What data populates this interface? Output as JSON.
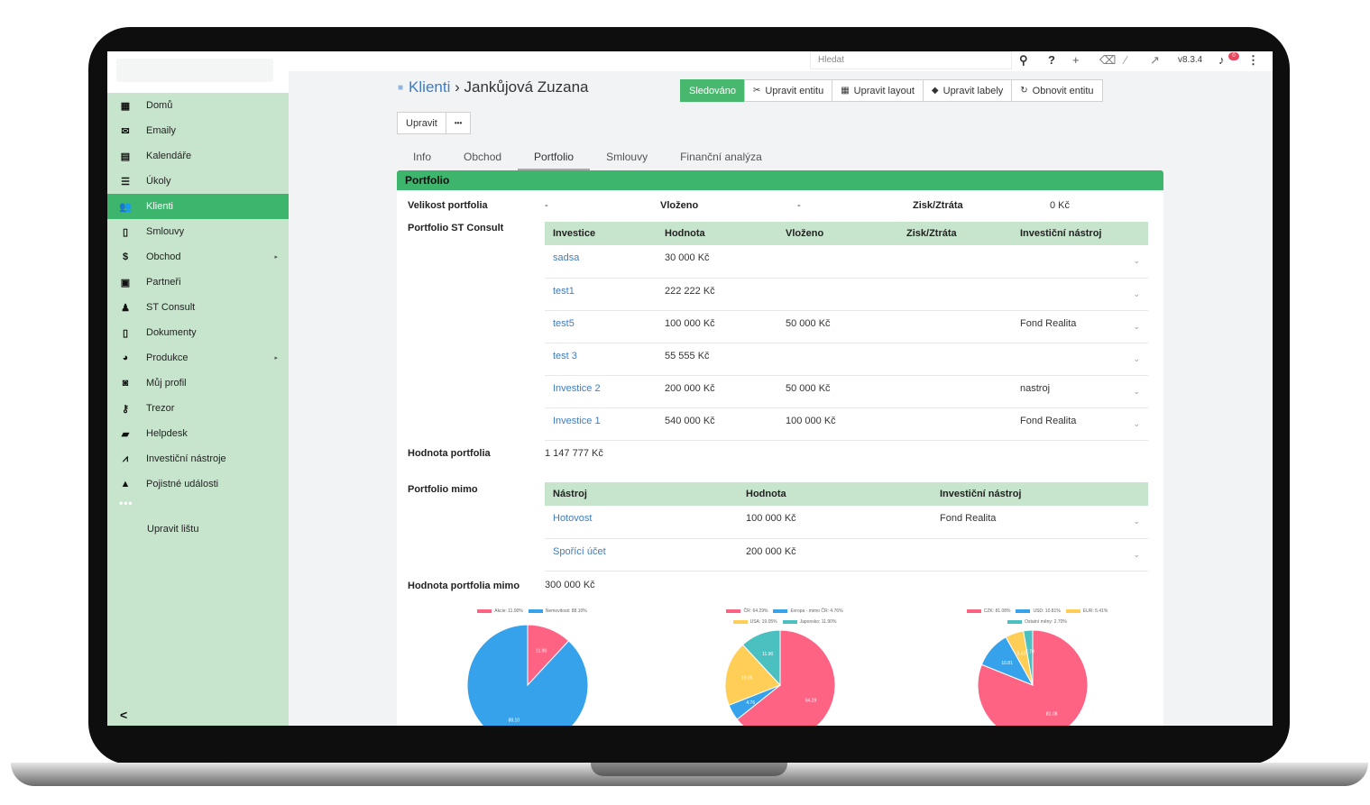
{
  "sidebar": {
    "items": [
      {
        "icon": "▦",
        "label": "Domů",
        "name": "grid-icon"
      },
      {
        "icon": "✉",
        "label": "Emaily",
        "name": "envelope-icon"
      },
      {
        "icon": "▤",
        "label": "Kalendáře",
        "name": "calendar-icon"
      },
      {
        "icon": "☰",
        "label": "Úkoly",
        "name": "tasks-icon"
      },
      {
        "icon": "👥",
        "label": "Klienti",
        "name": "users-icon",
        "active": true
      },
      {
        "icon": "▯",
        "label": "Smlouvy",
        "name": "document-icon"
      },
      {
        "icon": "$",
        "label": "Obchod",
        "name": "dollar-icon",
        "arrow": true
      },
      {
        "icon": "▣",
        "label": "Partneři",
        "name": "building-icon"
      },
      {
        "icon": "♟",
        "label": "ST Consult",
        "name": "person-icon"
      },
      {
        "icon": "▯",
        "label": "Dokumenty",
        "name": "file-icon"
      },
      {
        "icon": "◕",
        "label": "Produkce",
        "name": "pie-icon",
        "arrow": true
      },
      {
        "icon": "◙",
        "label": "Můj profil",
        "name": "profile-icon"
      },
      {
        "icon": "⚷",
        "label": "Trezor",
        "name": "key-icon"
      },
      {
        "icon": "▰",
        "label": "Helpdesk",
        "name": "briefcase-icon"
      },
      {
        "icon": "⩘",
        "label": "Investiční nástroje",
        "name": "chart-line-icon"
      },
      {
        "icon": "▲",
        "label": "Pojistné události",
        "name": "warning-icon"
      }
    ],
    "more": "•••",
    "edit_label": "Upravit lištu",
    "collapse": "<"
  },
  "topbar": {
    "search_placeholder": "Hledat",
    "version": "v8.3.4",
    "notifications": "0"
  },
  "header": {
    "breadcrumb_parent": "Klienti",
    "separator": "›",
    "title": "Jankůjová Zuzana",
    "buttons": {
      "follow": "Sledováno",
      "edit_entity": "Upravit entitu",
      "edit_layout": "Upravit layout",
      "edit_labels": "Upravit labely",
      "refresh_entity": "Obnovit entitu"
    },
    "edit": "Upravit",
    "more": "•••"
  },
  "tabs": [
    "Info",
    "Obchod",
    "Portfolio",
    "Smlouvy",
    "Finanční analýza"
  ],
  "portfolio": {
    "panel_title": "Portfolio",
    "size_label": "Velikost portfolia",
    "size_value": "-",
    "invested_label": "Vloženo",
    "invested_value": "-",
    "profit_label": "Zisk/Ztráta",
    "profit_value": "0 Kč",
    "st_label": "Portfolio ST Consult",
    "st_headers": [
      "Investice",
      "Hodnota",
      "Vloženo",
      "Zisk/Ztráta",
      "Investiční nástroj"
    ],
    "st_rows": [
      {
        "name": "sadsa",
        "value": "30 000 Kč",
        "invested": "",
        "profit": "",
        "tool": ""
      },
      {
        "name": "test1",
        "value": "222 222 Kč",
        "invested": "",
        "profit": "",
        "tool": ""
      },
      {
        "name": "test5",
        "value": "100 000 Kč",
        "invested": "50 000 Kč",
        "profit": "",
        "tool": "Fond Realita"
      },
      {
        "name": "test 3",
        "value": "55 555 Kč",
        "invested": "",
        "profit": "",
        "tool": ""
      },
      {
        "name": "Investice 2",
        "value": "200 000 Kč",
        "invested": "50 000 Kč",
        "profit": "",
        "tool": "nastroj"
      },
      {
        "name": "Investice 1",
        "value": "540 000 Kč",
        "invested": "100 000 Kč",
        "profit": "",
        "tool": "Fond Realita"
      }
    ],
    "value_label": "Hodnota portfolia",
    "value_value": "1 147 777 Kč",
    "outside_label": "Portfolio mimo",
    "outside_headers": [
      "Nástroj",
      "Hodnota",
      "Investiční nástroj"
    ],
    "outside_rows": [
      {
        "name": "Hotovost",
        "value": "100 000 Kč",
        "tool": "Fond Realita"
      },
      {
        "name": "Spořící účet",
        "value": "200 000 Kč",
        "tool": ""
      }
    ],
    "outside_value_label": "Hodnota portfolia mimo",
    "outside_value_value": "300 000 Kč"
  },
  "chart_data": [
    {
      "type": "pie",
      "categories": [
        "Akcie: 11.90%",
        "Nemovitosti: 88.10%"
      ],
      "values": [
        11.9,
        88.1
      ],
      "colors": [
        "#ff6384",
        "#36a2eb"
      ]
    },
    {
      "type": "pie",
      "categories": [
        "ČR: 64.29%",
        "Evropa - mimo ČR: 4.76%",
        "USA: 19.05%",
        "Japonsko: 11.90%"
      ],
      "values": [
        64.29,
        4.76,
        19.05,
        11.9
      ],
      "colors": [
        "#ff6384",
        "#36a2eb",
        "#ffce56",
        "#4bc0c0"
      ]
    },
    {
      "type": "pie",
      "categories": [
        "CZK: 81.08%",
        "USD: 10.81%",
        "EUR: 5.41%",
        "Ostatní měny: 2.70%"
      ],
      "values": [
        81.08,
        10.81,
        5.41,
        2.7
      ],
      "colors": [
        "#ff6384",
        "#36a2eb",
        "#ffce56",
        "#4bc0c0"
      ]
    }
  ]
}
